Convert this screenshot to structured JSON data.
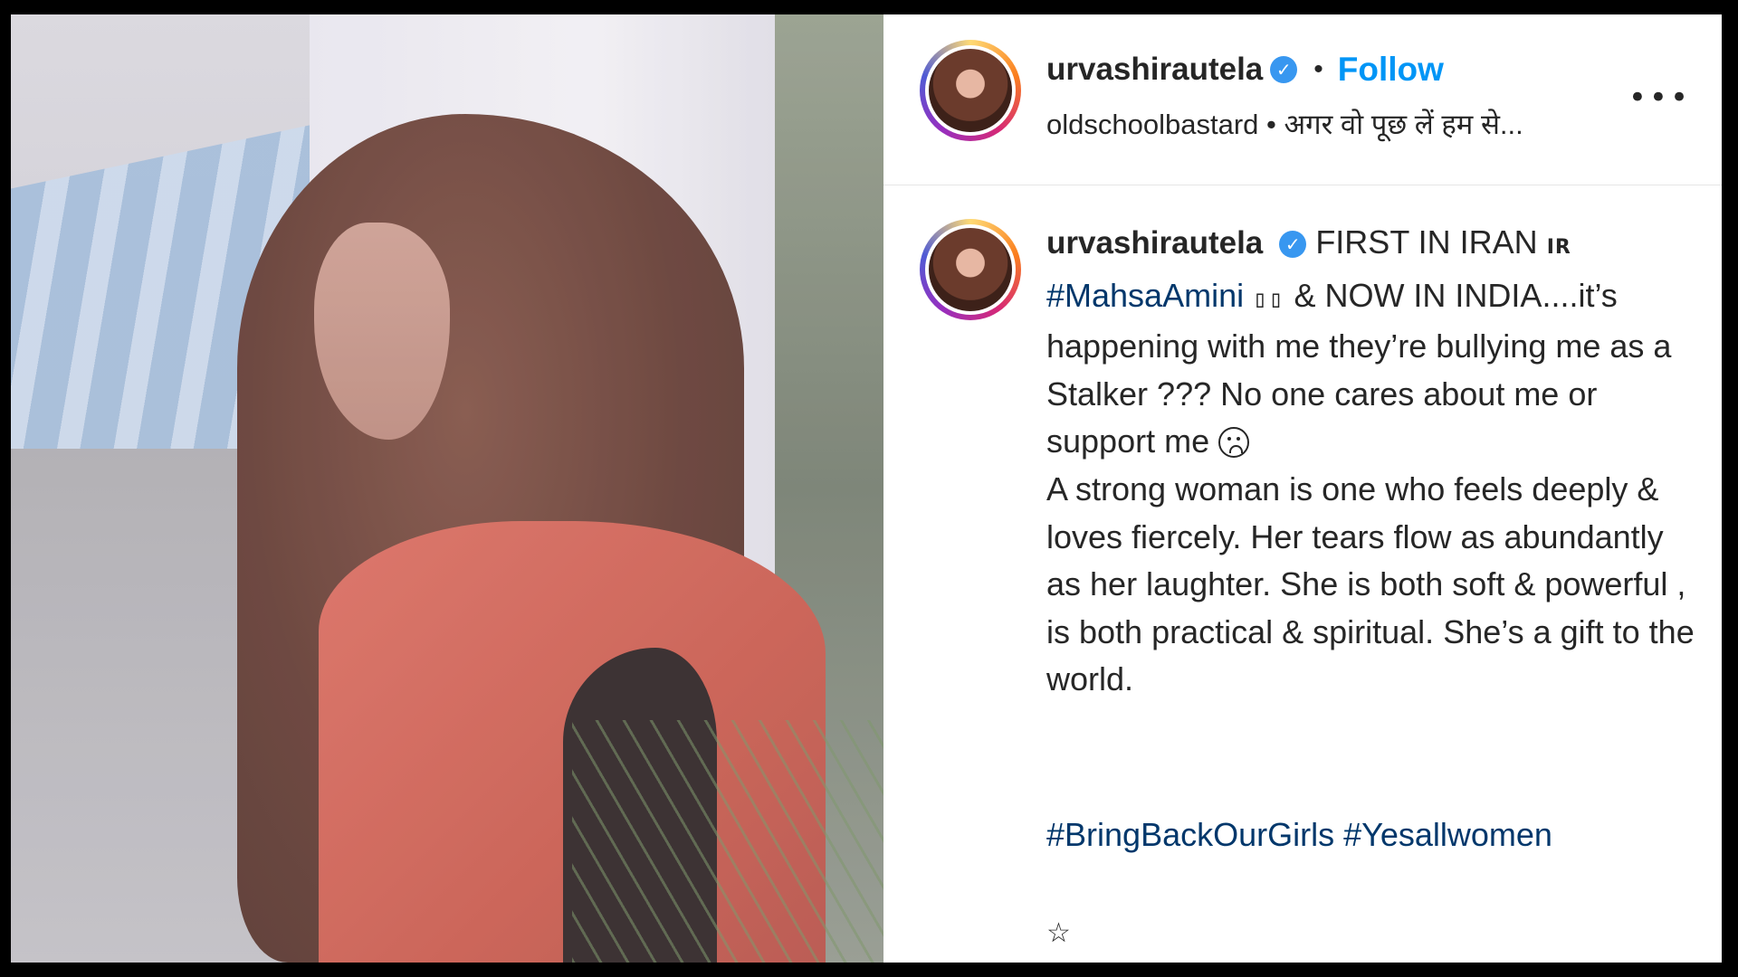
{
  "post": {
    "username": "urvashirautela",
    "verified_mark": "✓",
    "separator": "•",
    "follow_label": "Follow",
    "audio_line": "oldschoolbastard • अगर वो पूछ लें हम से...",
    "more_label": "•••"
  },
  "caption": {
    "username": "urvashirautela",
    "verified_mark": "✓",
    "part1": "FIRST IN IRAN",
    "flag": "IR",
    "hashtag_mahsa": "#MahsaAmini",
    "boxes": "▯▯",
    "part2": "& NOW IN INDIA....it’s happening with me they’re bullying me as a Stalker ??? No one cares about me or support me",
    "part3": "A strong woman is one who feels deeply & loves fiercely. Her tears flow as abundantly as her laughter. She is both soft & powerful , is both practical & spiritual. She’s a gift to the world.",
    "tag1": "#BringBackOurGirls",
    "tag2": "#Yesallwomen",
    "star": "☆"
  },
  "icons": {
    "verified": "verified-badge-icon",
    "more": "more-options-icon",
    "emoji": "sad-face-emoji-icon",
    "star": "star-icon"
  },
  "colors": {
    "follow": "#0095f6",
    "hashtag": "#00376b",
    "verified": "#3897f0",
    "text": "#262626"
  }
}
